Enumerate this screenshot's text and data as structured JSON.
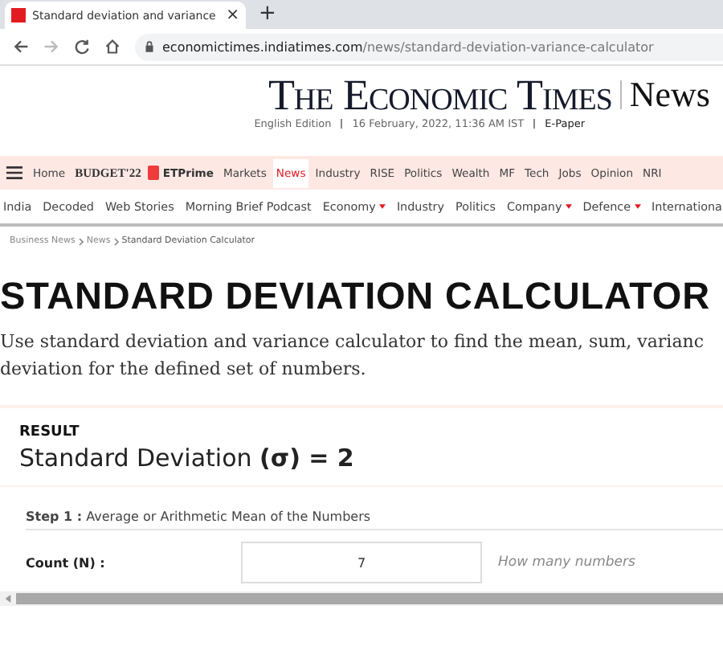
{
  "browser": {
    "tab_title": "Standard deviation and variance",
    "close_symbol": "×",
    "new_tab_symbol": "+",
    "url_domain": "economictimes.indiatimes.com",
    "url_path": "/news/standard-deviation-variance-calculator"
  },
  "masthead": {
    "title": "The Economic Times",
    "section": "News",
    "edition": "English Edition",
    "date": "16 February, 2022, 11:36 AM IST",
    "epaper": "E-Paper"
  },
  "nav": [
    {
      "label": "Home",
      "kind": "link",
      "selected": false
    },
    {
      "label": "BUDGET'22",
      "kind": "budget",
      "selected": false
    },
    {
      "label": "ETPrime",
      "kind": "prime",
      "selected": false
    },
    {
      "label": "Markets",
      "kind": "link",
      "selected": false
    },
    {
      "label": "News",
      "kind": "link",
      "selected": true
    },
    {
      "label": "Industry",
      "kind": "link",
      "selected": false
    },
    {
      "label": "RISE",
      "kind": "link",
      "selected": false
    },
    {
      "label": "Politics",
      "kind": "link",
      "selected": false
    },
    {
      "label": "Wealth",
      "kind": "link",
      "selected": false
    },
    {
      "label": "MF",
      "kind": "link",
      "selected": false
    },
    {
      "label": "Tech",
      "kind": "link",
      "selected": false
    },
    {
      "label": "Jobs",
      "kind": "link",
      "selected": false
    },
    {
      "label": "Opinion",
      "kind": "link",
      "selected": false
    },
    {
      "label": "NRI",
      "kind": "link",
      "selected": false
    }
  ],
  "subnav": [
    {
      "label": "India",
      "dropdown": false
    },
    {
      "label": "Decoded",
      "dropdown": false
    },
    {
      "label": "Web Stories",
      "dropdown": false
    },
    {
      "label": "Morning Brief Podcast",
      "dropdown": false
    },
    {
      "label": "Economy",
      "dropdown": true
    },
    {
      "label": "Industry",
      "dropdown": false
    },
    {
      "label": "Politics",
      "dropdown": false
    },
    {
      "label": "Company",
      "dropdown": true
    },
    {
      "label": "Defence",
      "dropdown": true
    },
    {
      "label": "Internationa",
      "dropdown": false
    }
  ],
  "breadcrumb": [
    "Business News",
    "News",
    "Standard Deviation Calculator"
  ],
  "heading": "STANDARD DEVIATION CALCULATOR",
  "intro": "Use standard deviation and variance calculator to find the mean, sum, varianc deviation for the defined set of numbers.",
  "result": {
    "label": "RESULT",
    "value": "Standard Deviation **(σ) = 2**"
  },
  "step": "**Step 1 :** Average or Arithmetic Mean of the Numbers",
  "count": {
    "label": "Count (N) :",
    "value": "7",
    "hint": "How many numbers"
  }
}
